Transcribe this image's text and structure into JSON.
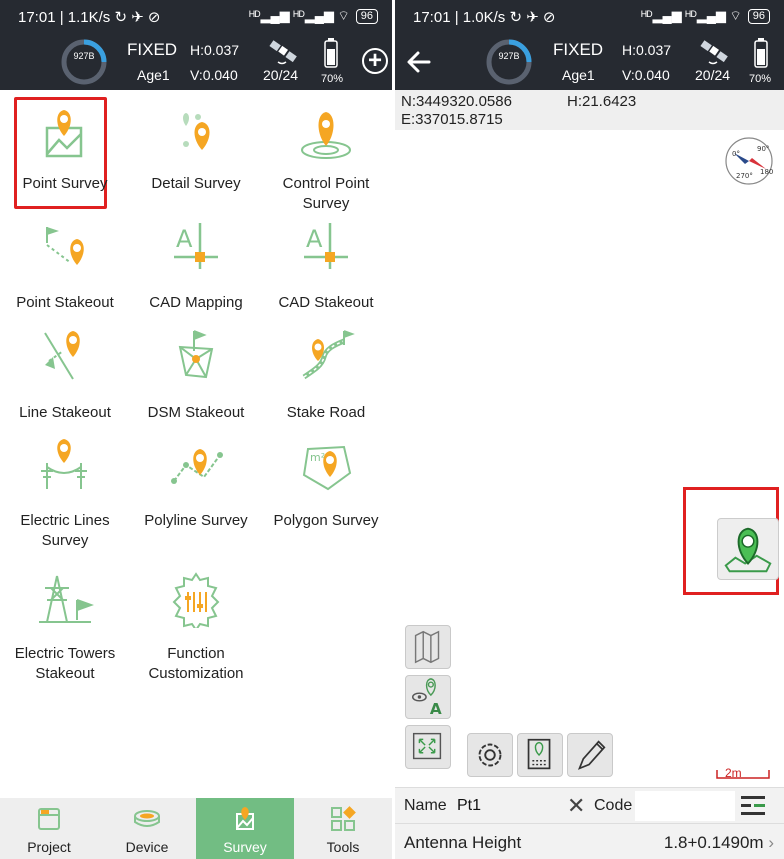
{
  "left_status": {
    "time": "17:01 | 1.1K/s ↻ ✈ ⊘",
    "signal": "ᴴᴰ▂▄▆ ᴴᴰ▂▄▆ ⌔",
    "battery": "96"
  },
  "right_status": {
    "time": "17:01 | 1.0K/s ↻ ✈ ⊘",
    "signal": "ᴴᴰ▂▄▆ ᴴᴰ▂▄▆ ⌔",
    "battery": "96"
  },
  "gnss": {
    "ring_label": "927B",
    "fix": "FIXED",
    "age": "Age1",
    "h_precision": "H:0.037",
    "v_precision": "V:0.040",
    "satellites": "20/24",
    "battery": "70%"
  },
  "menu": [
    {
      "label": "Point Survey",
      "icon": "point-survey-icon"
    },
    {
      "label": "Detail Survey",
      "icon": "detail-survey-icon"
    },
    {
      "label": "Control Point Survey",
      "icon": "control-point-survey-icon"
    },
    {
      "label": "Point Stakeout",
      "icon": "point-stakeout-icon"
    },
    {
      "label": "CAD Mapping",
      "icon": "cad-mapping-icon"
    },
    {
      "label": "CAD Stakeout",
      "icon": "cad-stakeout-icon"
    },
    {
      "label": "Line Stakeout",
      "icon": "line-stakeout-icon"
    },
    {
      "label": "DSM Stakeout",
      "icon": "dsm-stakeout-icon"
    },
    {
      "label": "Stake Road",
      "icon": "stake-road-icon"
    },
    {
      "label": "Electric Lines Survey",
      "icon": "electric-lines-icon"
    },
    {
      "label": "Polyline Survey",
      "icon": "polyline-survey-icon"
    },
    {
      "label": "Polygon Survey",
      "icon": "polygon-survey-icon"
    },
    {
      "label": "Electric Towers Stakeout",
      "icon": "electric-towers-icon"
    },
    {
      "label": "Function Customization",
      "icon": "function-customization-icon"
    }
  ],
  "nav": [
    {
      "label": "Project",
      "icon": "project-icon"
    },
    {
      "label": "Device",
      "icon": "device-icon"
    },
    {
      "label": "Survey",
      "icon": "survey-icon",
      "active": true
    },
    {
      "label": "Tools",
      "icon": "tools-icon"
    }
  ],
  "coords": {
    "n": "N:3449320.0586",
    "e": "E:337015.8715",
    "h": "H:21.6423"
  },
  "compass": {
    "deg0": "0°",
    "deg90": "90°",
    "deg180": "180°",
    "deg270": "270°"
  },
  "scale": "2m",
  "name_field": {
    "label": "Name",
    "value": "Pt1",
    "clear": "✕",
    "code_label": "Code"
  },
  "antenna": {
    "label": "Antenna Height",
    "value": "1.8+0.1490m",
    "chevron": "›"
  },
  "colors": {
    "header": "#262a31",
    "accent": "#72bd83",
    "pin": "#f5a623",
    "highlight": "#e02020"
  }
}
